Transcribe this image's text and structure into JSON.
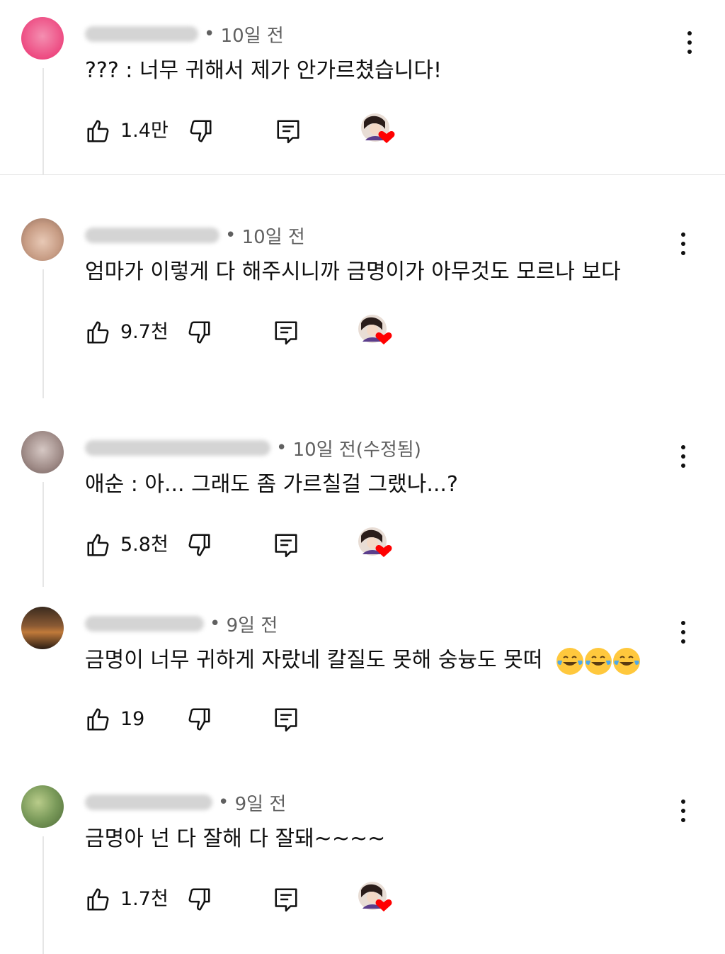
{
  "comments": [
    {
      "time": "10일 전",
      "text": "??? : 너무 귀해서 제가 안가르쳤습니다!",
      "likes": "1.4만",
      "creator_heart": true,
      "avatar_color": "#f06292"
    },
    {
      "time": "10일 전",
      "text": "엄마가 이렇게 다 해주시니까 금명이가 아무것도 모르나 보다",
      "likes": "9.7천",
      "creator_heart": true,
      "avatar_color": "#b98a78"
    },
    {
      "time": "10일 전(수정됨)",
      "text": "애순 : 아... 그래도 좀 가르칠걸 그랬나...?",
      "likes": "5.8천",
      "creator_heart": true,
      "avatar_color": "#a89a9a"
    },
    {
      "time": "9일 전",
      "text": "금명이 너무 귀하게 자랐네 칼질도 못해 숭늉도 못떠",
      "emoji_count": 3,
      "emoji_icon": "tears-of-joy-emoji",
      "likes": "19",
      "creator_heart": false,
      "avatar_color": "#6b4a2e"
    },
    {
      "time": "9일 전",
      "text": "금명아 넌 다 잘해 다 잘돼~~~~",
      "likes": "1.7천",
      "creator_heart": true,
      "avatar_color": "#7a9a5a"
    }
  ],
  "icons": {
    "like": "thumbs-up-icon",
    "dislike": "thumbs-down-icon",
    "reply": "reply-icon",
    "more": "more-vertical-icon",
    "heart": "creator-heart-icon"
  },
  "colors": {
    "heart": "#ff0000",
    "meta_text": "#606060"
  }
}
